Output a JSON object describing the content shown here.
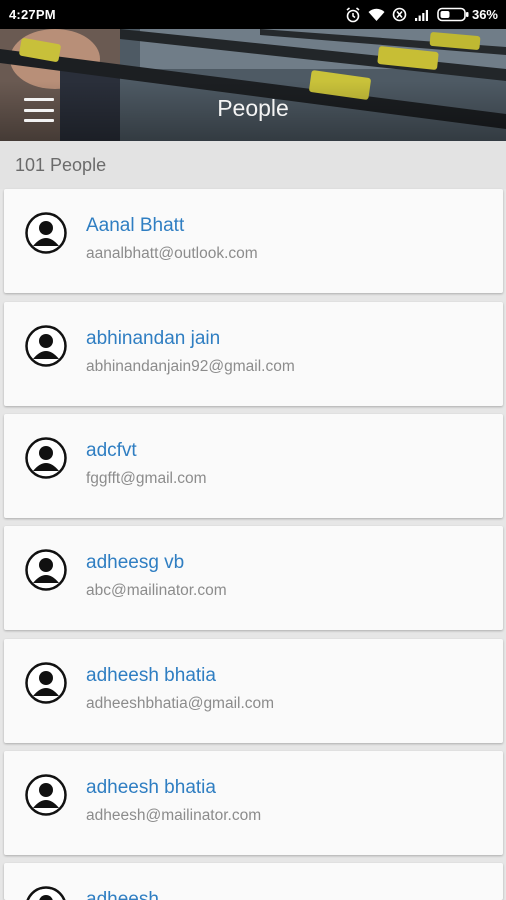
{
  "status_bar": {
    "time": "4:27PM",
    "battery": "36%",
    "icons": [
      "alarm-icon",
      "wifi-icon",
      "data-saver-icon",
      "signal-icon",
      "battery-icon"
    ]
  },
  "header": {
    "title": "People",
    "menu_icon": "hamburger-menu-icon"
  },
  "people_count": "101 People",
  "people": [
    {
      "name": "Aanal Bhatt",
      "email": "aanalbhatt@outlook.com"
    },
    {
      "name": "abhinandan jain",
      "email": "abhinandanjain92@gmail.com"
    },
    {
      "name": "adcfvt",
      "email": "fggfft@gmail.com"
    },
    {
      "name": "adheesg vb",
      "email": "abc@mailinator.com"
    },
    {
      "name": "adheesh bhatia",
      "email": "adheeshbhatia@gmail.com"
    },
    {
      "name": "adheesh bhatia",
      "email": "adheesh@mailinator.com"
    },
    {
      "name": "adheesh",
      "email": ""
    }
  ],
  "colors": {
    "name_link": "#2f7ec2",
    "email_text": "#8c8c8c",
    "background": "#e6e6e6",
    "card": "#fafafa"
  }
}
